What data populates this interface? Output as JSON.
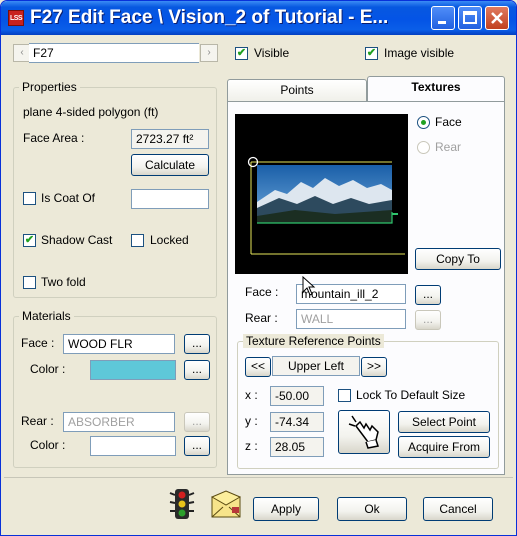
{
  "window": {
    "title": "F27 Edit Face \\ Vision_2 of Tutorial - E...",
    "app_icon_text": "LSS",
    "controls": [
      "minimize",
      "maximize",
      "close"
    ]
  },
  "top_bar": {
    "face_id": "F27",
    "visible_label": "Visible",
    "visible_checked": true,
    "image_visible_label": "Image visible",
    "image_visible_checked": true
  },
  "properties": {
    "group_label": "Properties",
    "description": "plane  4-sided polygon  (ft)",
    "face_area_label": "Face Area :",
    "face_area_value": "2723.27 ft²",
    "calculate_label": "Calculate",
    "is_coat_of_label": "Is Coat Of",
    "is_coat_of_checked": false,
    "is_coat_of_value": "",
    "shadow_cast_label": "Shadow Cast",
    "shadow_cast_checked": true,
    "locked_label": "Locked",
    "locked_checked": false,
    "two_fold_label": "Two fold",
    "two_fold_checked": false
  },
  "materials": {
    "group_label": "Materials",
    "face_label": "Face :",
    "face_value": "WOOD FLR",
    "face_color_label": "Color :",
    "face_color": "#5ec8d9",
    "rear_label": "Rear :",
    "rear_value": "ABSORBER",
    "rear_color_label": "Color :",
    "browse_label": "..."
  },
  "tabs": {
    "points_label": "Points",
    "textures_label": "Textures",
    "active": "textures"
  },
  "textures": {
    "face_radio_label": "Face",
    "rear_radio_label": "Rear",
    "copy_to_label": "Copy To",
    "face_label": "Face :",
    "face_value": "mountain_ill_2",
    "rear_label": "Rear :",
    "rear_value": "WALL",
    "browse_label": "...",
    "ref_points_label": "Texture Reference Points",
    "prev_label": "<<",
    "next_label": ">>",
    "ref_point_value": "Upper Left",
    "x_label": "x :",
    "x_value": "-50.00",
    "y_label": "y :",
    "y_value": "-74.34",
    "z_label": "z :",
    "z_value": "28.05",
    "lock_default_label": "Lock To Default Size",
    "lock_default_checked": false,
    "select_point_label": "Select Point",
    "acquire_from_label": "Acquire From"
  },
  "footer": {
    "apply_label": "Apply",
    "ok_label": "Ok",
    "cancel_label": "Cancel"
  },
  "icons": {
    "traffic_light": "traffic-light-icon",
    "envelope": "envelope-icon",
    "hand_pointer": "hand-pointer-icon",
    "cursor": "mouse-cursor-icon"
  }
}
